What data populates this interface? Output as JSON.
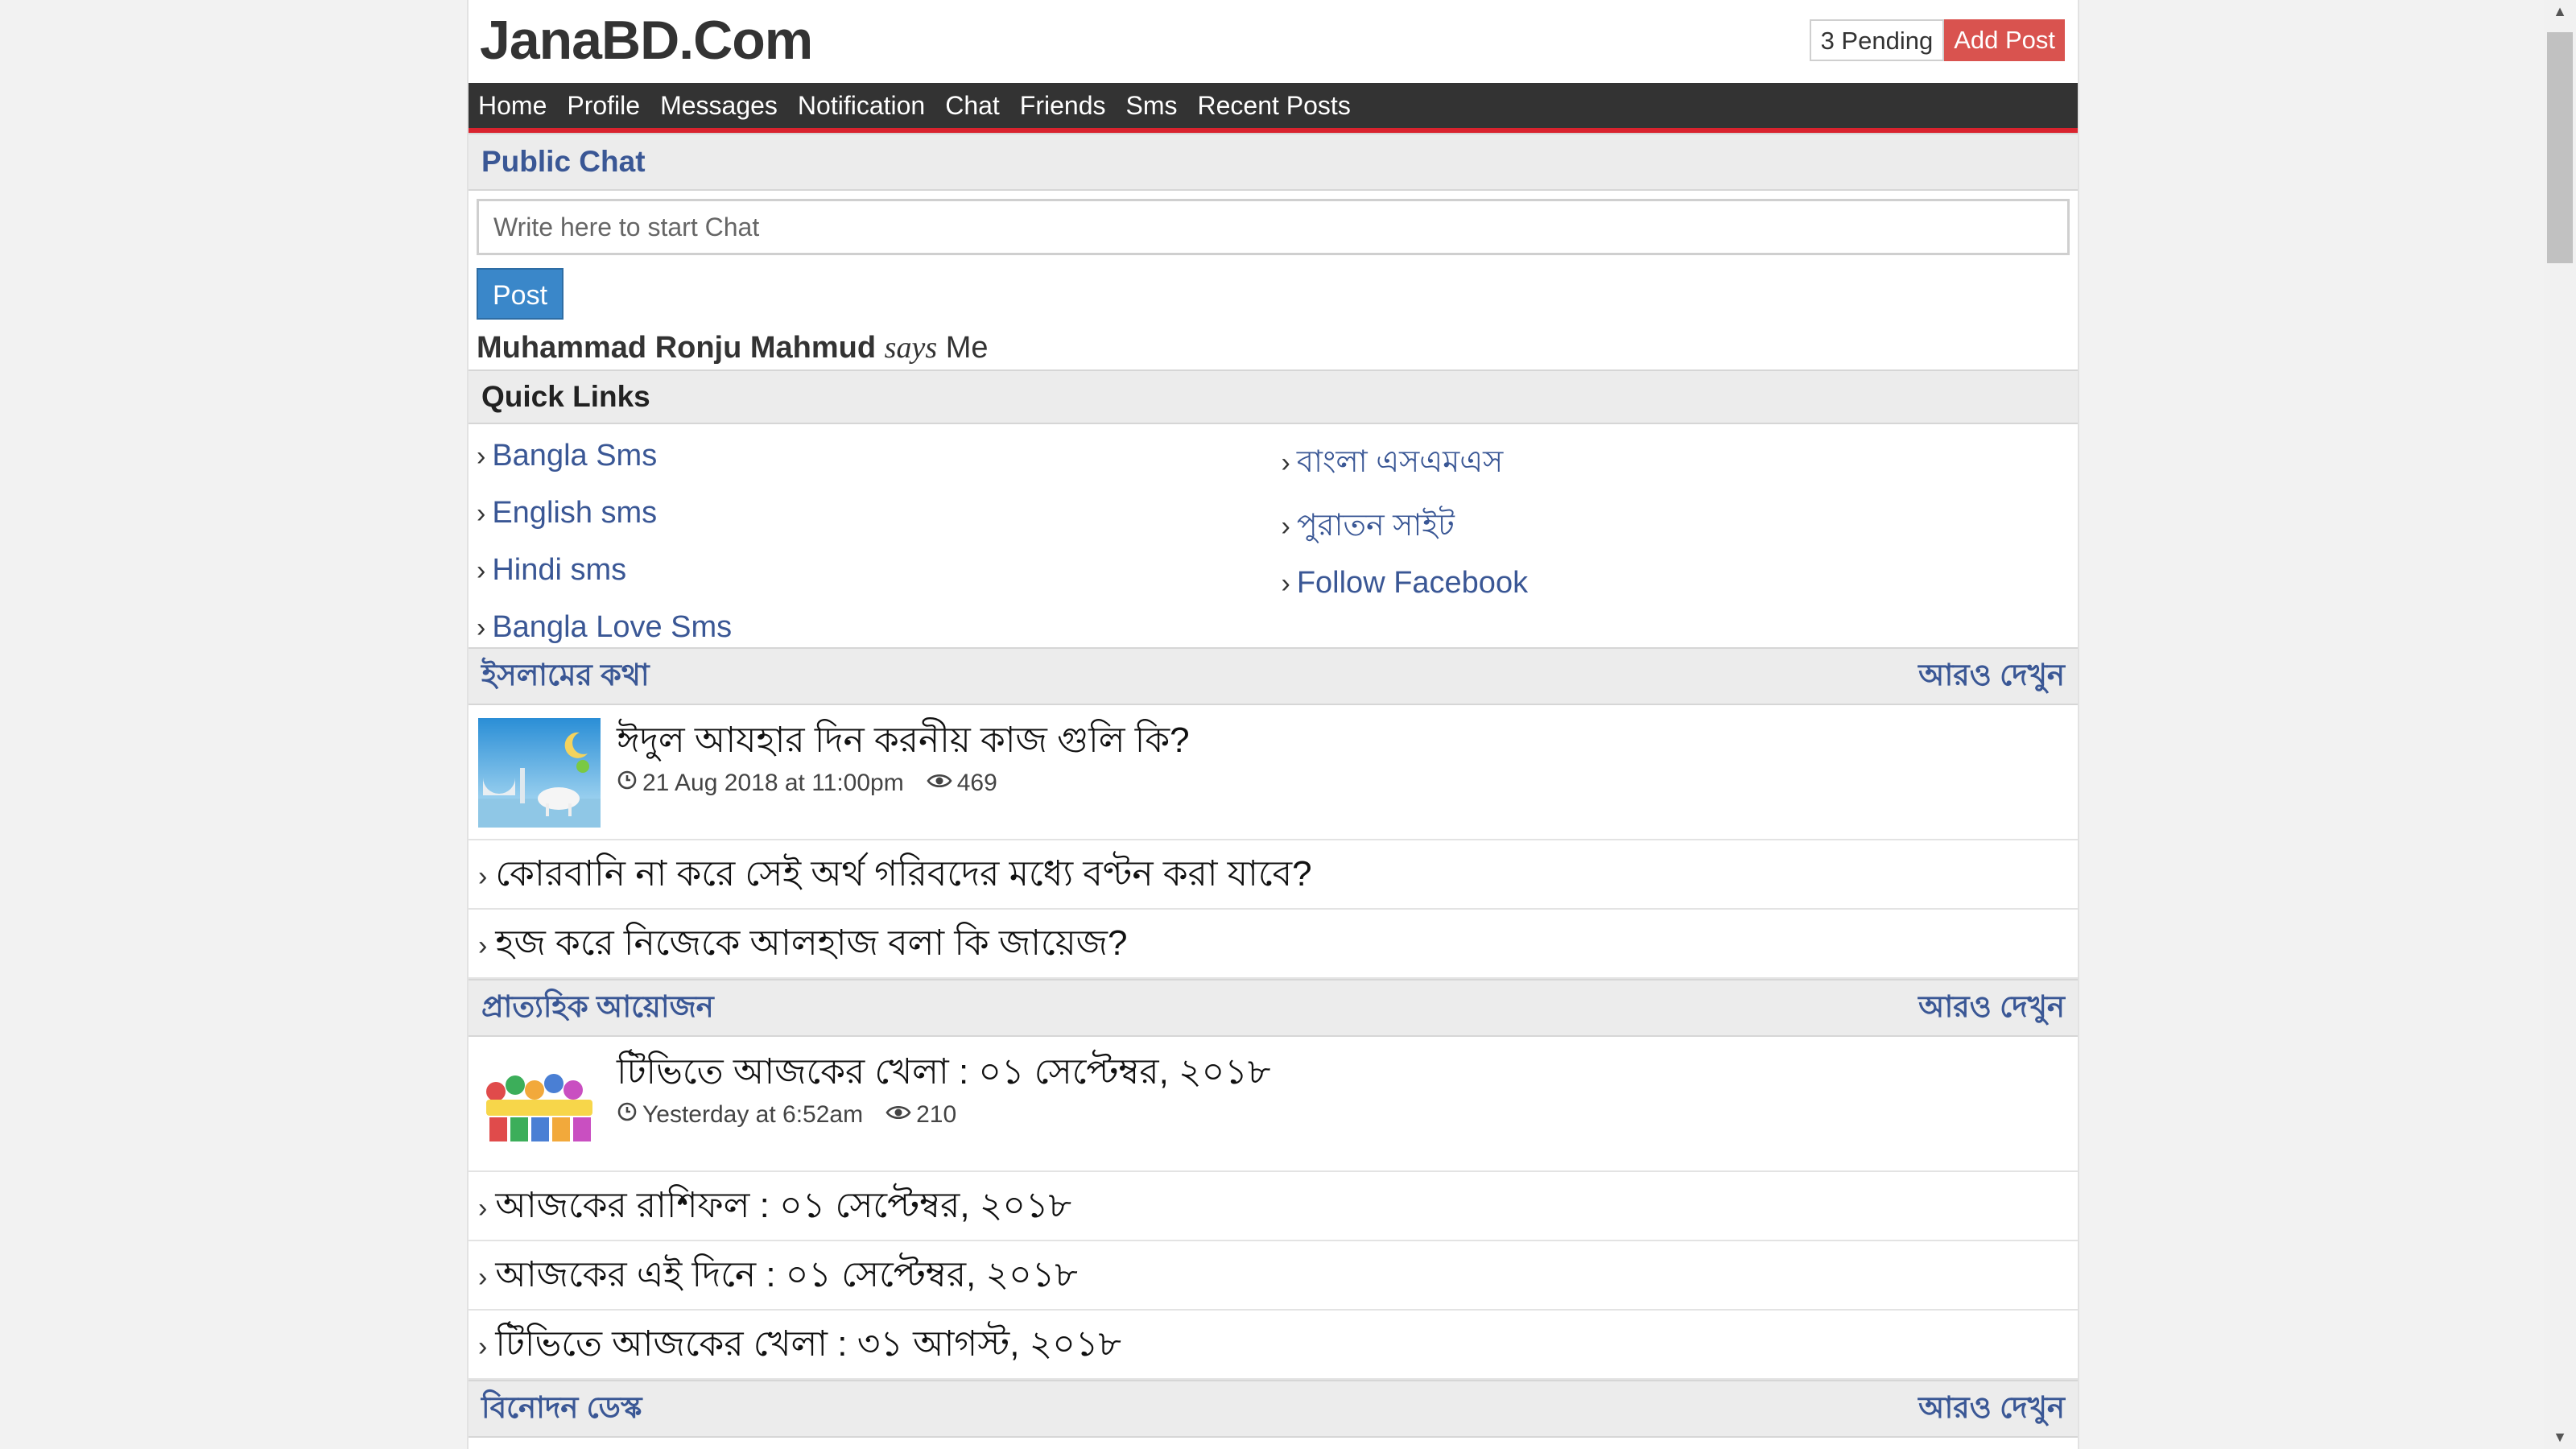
{
  "header": {
    "logo_text": "JanaBD.Com",
    "pending_label": "3 Pending",
    "add_post_label": "Add Post"
  },
  "nav": {
    "items": [
      "Home",
      "Profile",
      "Messages",
      "Notification",
      "Chat",
      "Friends",
      "Sms",
      "Recent Posts"
    ]
  },
  "chat": {
    "title": "Public Chat",
    "placeholder": "Write here to start Chat",
    "post_label": "Post",
    "last_message": {
      "author": "Muhammad Ronju Mahmud",
      "verb": "says",
      "text": "Me"
    }
  },
  "quick_links": {
    "title": "Quick Links",
    "arrow": "›",
    "left": [
      "Bangla Sms",
      "English sms",
      "Hindi sms",
      "Bangla Love Sms"
    ],
    "right": [
      "বাংলা এসএমএস",
      "পুরাতন সাইট",
      "Follow Facebook"
    ]
  },
  "sections": [
    {
      "title": "ইসলামের কথা",
      "more": "আরও দেখুন",
      "featured": {
        "title": "ঈদুল আযহার দিন করনীয় কাজ গুলি কি?",
        "date": "21 Aug 2018 at 11:00pm",
        "views": "469"
      },
      "items": [
        "কোরবানি না করে সেই অর্থ গরিবদের মধ্যে বণ্টন করা যাবে?",
        "হজ করে নিজেকে আলহাজ বলা কি জায়েজ?"
      ]
    },
    {
      "title": "প্রাত্যহিক আয়োজন",
      "more": "আরও দেখুন",
      "featured": {
        "title": "টিভিতে আজকের খেলা : ০১ সেপ্টেম্বর, ২০১৮",
        "date": "Yesterday at 6:52am",
        "views": "210"
      },
      "items": [
        "আজকের রাশিফল : ০১ সেপ্টেম্বর, ২০১৮",
        "আজকের এই দিনে : ০১ সেপ্টেম্বর, ২০১৮",
        "টিভিতে আজকের খেলা : ৩১ আগস্ট, ২০১৮"
      ]
    },
    {
      "title": "বিনোদন ডেস্ক",
      "more": "আরও দেখুন"
    }
  ],
  "colors": {
    "link": "#3a5795",
    "nav_bg": "#333333",
    "nav_accent": "#d9232e",
    "add_post": "#d9534f",
    "post_button": "#3a87c9"
  }
}
